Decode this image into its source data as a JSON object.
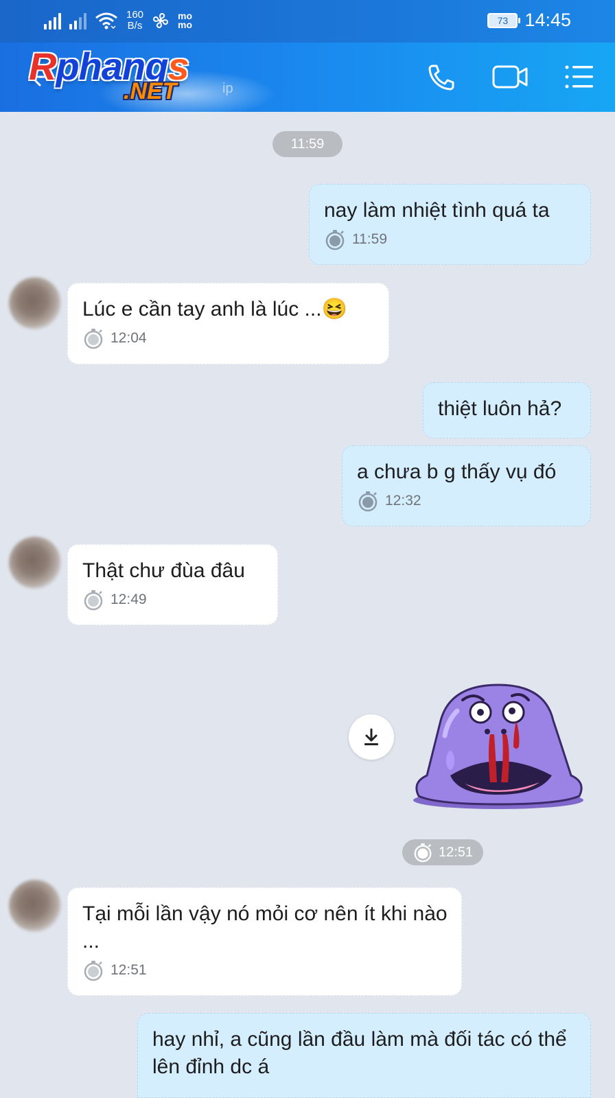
{
  "status_bar": {
    "speed_value": "160",
    "speed_unit": "B/s",
    "momo_top": "mo",
    "momo_bottom": "mo",
    "battery": "73",
    "time": "14:45"
  },
  "header": {
    "logo_first": "R",
    "logo_mid": "phang",
    "logo_last": "s",
    "logo_net": ".NET",
    "subtitle_fragment": "ip"
  },
  "chat": {
    "pill_1159": "11:59",
    "messages": [
      {
        "text": "nay làm nhiệt tình quá ta",
        "time": "11:59"
      },
      {
        "text": "Lúc e cần tay anh là lúc ...😆",
        "time": "12:04"
      },
      {
        "text": "thiệt luôn hả?"
      },
      {
        "text": "a chưa b g thấy vụ đó",
        "time": "12:32"
      },
      {
        "text": "Thật chư đùa đâu",
        "time": "12:49"
      },
      {
        "text": "Tại mỗi lần vậy nó mỏi cơ nên ít khi nào ...",
        "time": "12:51"
      },
      {
        "text": "hay nhỉ, a cũng lần đầu làm mà đối tác có thể lên đỉnh dc á"
      }
    ],
    "sticker_time": "12:51"
  },
  "colors": {
    "header_start": "#1a6fe0",
    "header_end": "#17a6f4",
    "bubble_out": "#d5eefd",
    "bubble_in": "#ffffff",
    "chat_bg": "#e1e6ee"
  }
}
